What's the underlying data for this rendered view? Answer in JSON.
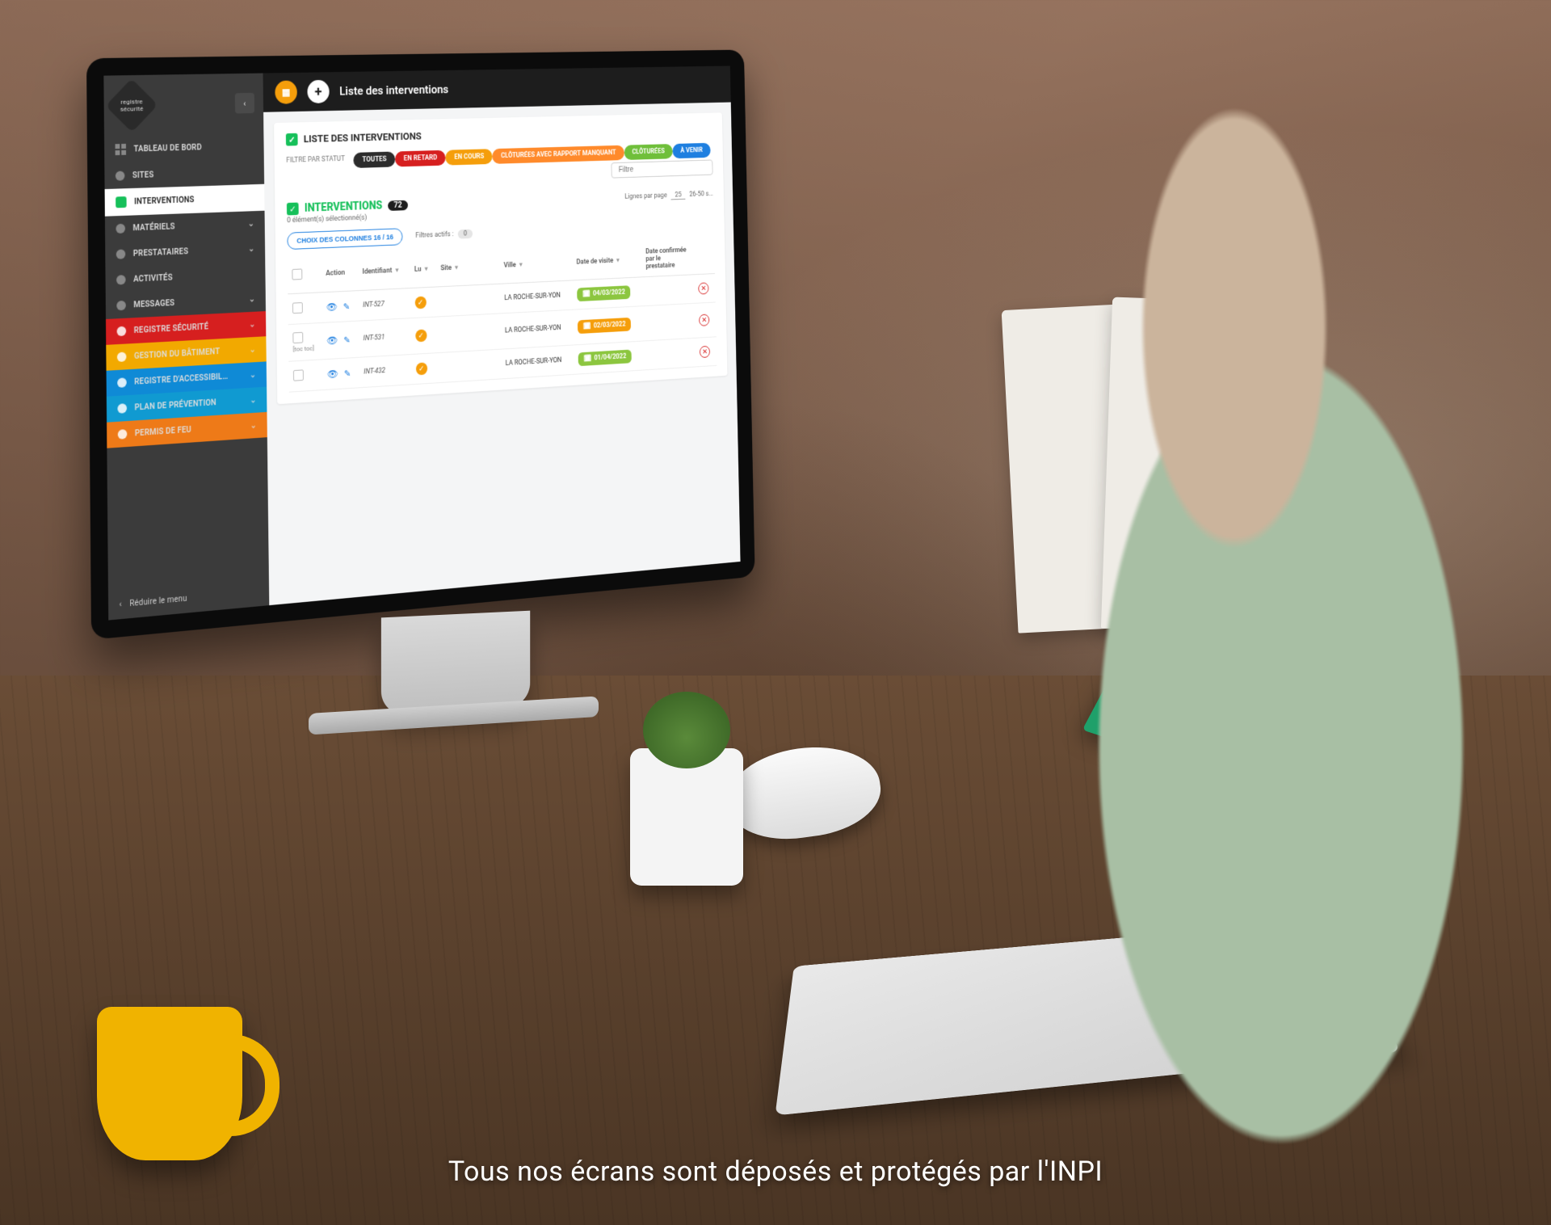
{
  "footer_caption": "Tous nos écrans sont déposés et protégés par l'INPI",
  "logo_text": "registre sécurité",
  "sidebar": {
    "collapse_icon": "‹",
    "reduce_label": "Réduire le menu",
    "items": [
      {
        "label": "TABLEAU DE BORD",
        "icon": "grid",
        "chev": false
      },
      {
        "label": "SITES",
        "icon": "dot",
        "chev": false
      },
      {
        "label": "INTERVENTIONS",
        "icon": "sq",
        "chev": false,
        "active": true
      },
      {
        "label": "MATÉRIELS",
        "icon": "dot",
        "chev": true
      },
      {
        "label": "PRESTATAIRES",
        "icon": "dot",
        "chev": true
      },
      {
        "label": "ACTIVITÉS",
        "icon": "dot",
        "chev": false
      },
      {
        "label": "MESSAGES",
        "icon": "dot",
        "chev": true
      }
    ],
    "registers": [
      {
        "label": "REGISTRE SÉCURITÉ",
        "color": "c-red"
      },
      {
        "label": "GESTION DU BÂTIMENT",
        "color": "c-yellow"
      },
      {
        "label": "REGISTRE D'ACCESSIBIL…",
        "color": "c-blue"
      },
      {
        "label": "PLAN DE PRÉVENTION",
        "color": "c-cyan"
      },
      {
        "label": "PERMIS DE FEU",
        "color": "c-orange"
      }
    ]
  },
  "topbar": {
    "title": "Liste des interventions",
    "grid_icon": "▦",
    "add_icon": "+"
  },
  "panel": {
    "title": "LISTE DES INTERVENTIONS",
    "filter_label": "FILTRE PAR STATUT",
    "search_placeholder": "Filtre",
    "status_filters": [
      {
        "label": "TOUTES",
        "cls": "pill-dark"
      },
      {
        "label": "EN RETARD",
        "cls": "pill-red"
      },
      {
        "label": "EN COURS",
        "cls": "pill-orange"
      },
      {
        "label": "CLÔTURÉES AVEC RAPPORT MANQUANT",
        "cls": "pill-lorange"
      },
      {
        "label": "CLÔTURÉES",
        "cls": "pill-green"
      },
      {
        "label": "À VENIR",
        "cls": "pill-blue"
      }
    ],
    "section_title": "INTERVENTIONS",
    "count_badge": "72",
    "selected_text": "0 élément(s) sélectionné(s)",
    "lines_per_page_label": "Lignes par page",
    "lines_per_page_value": "25",
    "range_text": "26-50 s...",
    "columns_button": "CHOIX DES COLONNES 16 / 16",
    "filters_active_label": "Filtres actifs :",
    "filters_active_count": "0"
  },
  "table": {
    "headers": {
      "action": "Action",
      "identifiant": "Identifiant",
      "lu": "Lu",
      "site": "Site",
      "ville": "Ville",
      "date_visite": "Date de visite",
      "date_conf": "Date confirmée par le prestataire"
    },
    "rows": [
      {
        "identifiant": "INT-527",
        "ville": "LA ROCHE-SUR-YON",
        "date": "04/03/2022",
        "date_cls": "dp-green",
        "note": ""
      },
      {
        "identifiant": "INT-531",
        "ville": "LA ROCHE-SUR-YON",
        "date": "02/03/2022",
        "date_cls": "dp-orange",
        "note": "[toc toc]"
      },
      {
        "identifiant": "INT-432",
        "ville": "LA ROCHE-SUR-YON",
        "date": "01/04/2022",
        "date_cls": "dp-green",
        "note": ""
      }
    ]
  }
}
